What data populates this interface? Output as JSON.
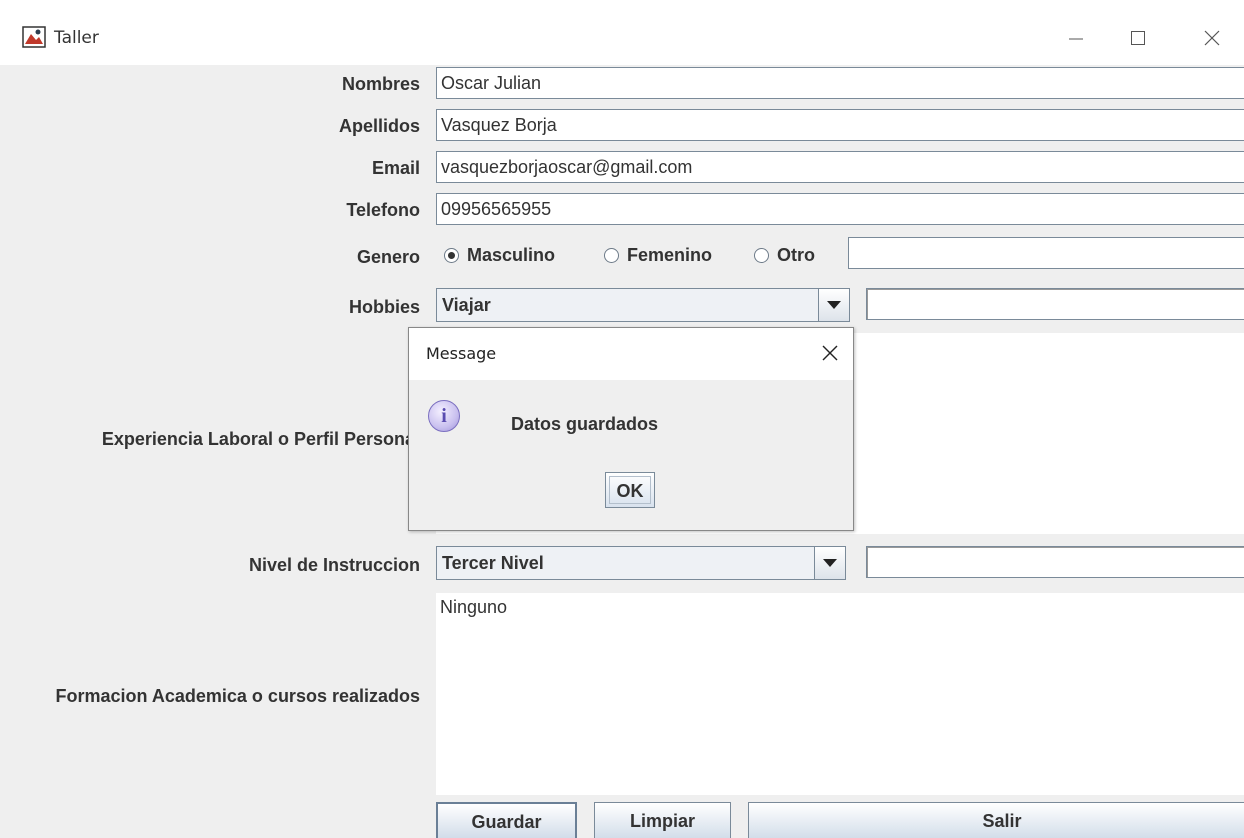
{
  "window": {
    "title": "Taller",
    "icons": [
      "app-icon",
      "minimize-icon",
      "maximize-icon",
      "close-icon"
    ]
  },
  "form": {
    "nombres_label": "Nombres",
    "nombres_value": "Oscar Julian",
    "apellidos_label": "Apellidos",
    "apellidos_value": "Vasquez Borja",
    "email_label": "Email",
    "email_value": "vasquezborjaoscar@gmail.com",
    "telefono_label": "Telefono",
    "telefono_value": "09956565955",
    "genero_label": "Genero",
    "genero_options": [
      "Masculino",
      "Femenino",
      "Otro"
    ],
    "genero_selected": "Masculino",
    "genero_otro_value": "",
    "hobbies_label": "Hobbies",
    "hobbies_selected": "Viajar",
    "hobbies_extra_value": "",
    "experiencia_label": "Experiencia Laboral o Perfil Personal",
    "experiencia_value": "",
    "nivel_label": "Nivel de Instruccion",
    "nivel_selected": "Tercer Nivel",
    "nivel_extra_value": "",
    "formacion_label": "Formacion Academica o cursos realizados",
    "formacion_value": "Ninguno"
  },
  "buttons": {
    "guardar": "Guardar",
    "limpiar": "Limpiar",
    "salir": "Salir"
  },
  "dialog": {
    "title": "Message",
    "message": "Datos guardados",
    "ok": "OK",
    "icon": "info-icon"
  }
}
